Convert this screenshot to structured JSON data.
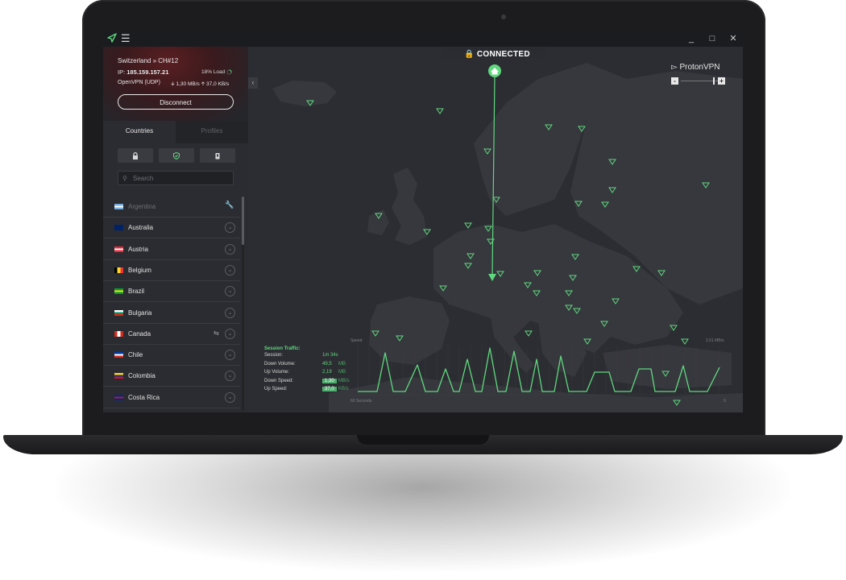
{
  "window": {
    "menu_icon": "hamburger-icon",
    "controls": [
      "_",
      "□",
      "✕"
    ]
  },
  "connection": {
    "server": "Switzerland » CH#12",
    "ip_label": "IP:",
    "ip": "185.159.157.21",
    "load": "18% Load",
    "protocol": "OpenVPN (UDP)",
    "down_speed": "1,30 MB/s",
    "up_speed": "37,0 KB/s",
    "disconnect_label": "Disconnect"
  },
  "tabs": {
    "countries": "Countries",
    "profiles": "Profiles"
  },
  "filters": [
    {
      "icon": "lock-icon"
    },
    {
      "icon": "shield-icon"
    },
    {
      "icon": "tor-icon"
    }
  ],
  "search": {
    "placeholder": "Search"
  },
  "countries": [
    {
      "name": "Argentina",
      "disabled": true,
      "action": "wrench-icon",
      "flag": [
        "#74acdf",
        "#ffffff",
        "#74acdf"
      ]
    },
    {
      "name": "Australia",
      "flag": [
        "#012169",
        "#012169",
        "#012169"
      ]
    },
    {
      "name": "Austria",
      "flag": [
        "#ed2939",
        "#ffffff",
        "#ed2939"
      ]
    },
    {
      "name": "Belgium",
      "flag_v": [
        "#000000",
        "#fdda24",
        "#ef3340"
      ]
    },
    {
      "name": "Brazil",
      "flag": [
        "#009c3b",
        "#ffdf00",
        "#009c3b"
      ]
    },
    {
      "name": "Bulgaria",
      "flag": [
        "#ffffff",
        "#00966e",
        "#d62612"
      ]
    },
    {
      "name": "Canada",
      "p2p": true,
      "flag_v": [
        "#d52b1e",
        "#ffffff",
        "#d52b1e"
      ]
    },
    {
      "name": "Chile",
      "flag": [
        "#0039a6",
        "#ffffff",
        "#d52b1e"
      ]
    },
    {
      "name": "Colombia",
      "flag": [
        "#fcd116",
        "#003893",
        "#ce1126"
      ]
    },
    {
      "name": "Costa Rica",
      "flag": [
        "#002b7f",
        "#ce1126",
        "#002b7f"
      ]
    }
  ],
  "map": {
    "status": "CONNECTED",
    "brand": "ProtonVPN",
    "zoom_out": "-",
    "zoom_in": "+"
  },
  "session_traffic": {
    "title": "Session Traffic:",
    "rows": [
      {
        "label": "Session:",
        "value": "1m 34s",
        "unit": ""
      },
      {
        "label": "Down Volume:",
        "value": "49,5",
        "unit": "MB"
      },
      {
        "label": "Up Volume:",
        "value": "2,19",
        "unit": "MB"
      },
      {
        "label": "Down Speed:",
        "value": "1,30",
        "unit": "MB/s",
        "highlight": true
      },
      {
        "label": "Up Speed:",
        "value": "37,0",
        "unit": "KB/s",
        "highlight": true
      }
    ]
  },
  "graph": {
    "y_label": "Speed",
    "max_label": "2,61 MB/s",
    "x_left": "60 Seconds",
    "x_right": "0",
    "color": "#5fd87e"
  },
  "colors": {
    "accent": "#5fd87e",
    "background": "#25262b",
    "sidebar": "#2b2c31"
  }
}
